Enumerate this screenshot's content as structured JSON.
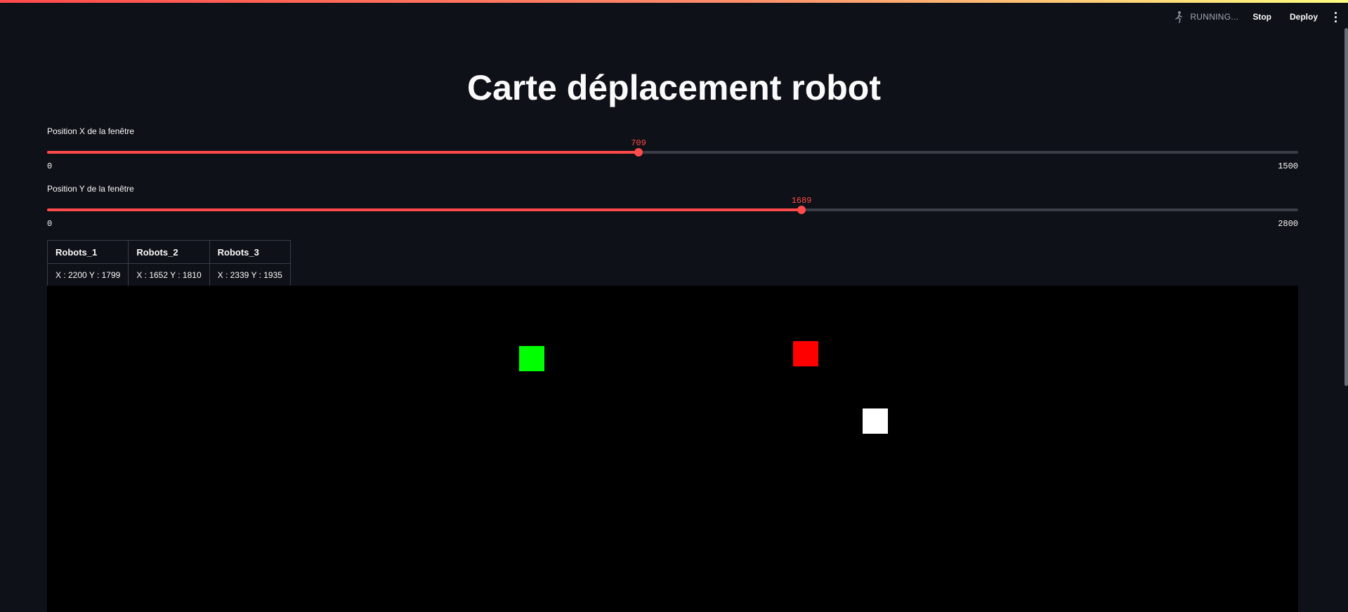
{
  "toolbar": {
    "status": "RUNNING...",
    "stop_label": "Stop",
    "deploy_label": "Deploy",
    "status_icon": "running-figure-icon",
    "menu_icon": "kebab-menu-icon"
  },
  "page": {
    "title": "Carte déplacement robot"
  },
  "sliders": [
    {
      "label": "Position X de la fenêtre",
      "value": "709",
      "min": "0",
      "max": "1500",
      "fraction": 0.4727
    },
    {
      "label": "Position Y de la fenêtre",
      "value": "1689",
      "min": "0",
      "max": "2800",
      "fraction": 0.6032
    }
  ],
  "robots_table": {
    "headers": [
      "Robots_1",
      "Robots_2",
      "Robots_3"
    ],
    "rows": [
      [
        "X : 2200 Y : 1799",
        "X : 1652 Y : 1810",
        "X : 2339 Y : 1935"
      ]
    ]
  },
  "map": {
    "background": "#000000",
    "robots": [
      {
        "name": "green",
        "color": "#00ff00"
      },
      {
        "name": "red",
        "color": "#ff0000"
      },
      {
        "name": "white",
        "color": "#ffffff"
      }
    ]
  },
  "colors": {
    "accent": "#ff4b4b",
    "background": "#0e1117",
    "track": "#3a3d46"
  }
}
